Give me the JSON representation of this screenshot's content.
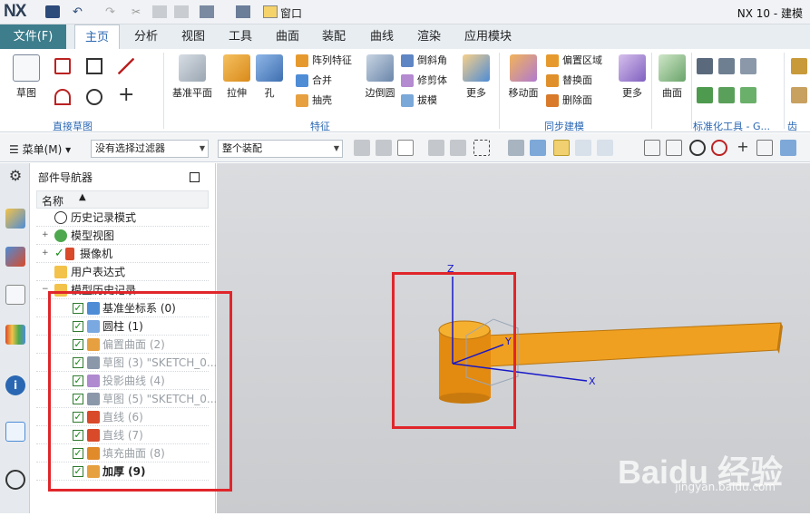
{
  "app": {
    "logo": "NX",
    "title": "NX 10 - 建模"
  },
  "quick_access": {
    "window_menu": "窗口"
  },
  "menu": {
    "file": "文件(F)",
    "tabs": [
      "主页",
      "分析",
      "视图",
      "工具",
      "曲面",
      "装配",
      "曲线",
      "渲染",
      "应用模块"
    ]
  },
  "ribbon": {
    "sketch": "草图",
    "group1": "直接草图",
    "datum_plane": "基准平面",
    "extrude": "拉伸",
    "hole": "孔",
    "pattern_feature": "阵列特征",
    "combine": "合并",
    "shell": "抽壳",
    "edge_blend": "边倒圆",
    "chamfer": "倒斜角",
    "trim_body": "修剪体",
    "draft": "拔模",
    "more": "更多",
    "group2": "特征",
    "move_face": "移动面",
    "offset_region": "偏置区域",
    "replace_face": "替换面",
    "delete_face": "删除面",
    "more2": "更多",
    "group3": "同步建模",
    "surface": "曲面",
    "group4": "标准化工具 - G...",
    "group5": "齿轮..."
  },
  "toolbar": {
    "menu": "菜单(M)",
    "filter": "没有选择过滤器",
    "assembly": "整个装配"
  },
  "navigator": {
    "title": "部件导航器",
    "col_name": "名称",
    "top_items": [
      {
        "label": "历史记录模式"
      },
      {
        "label": "模型视图"
      },
      {
        "label": "摄像机"
      },
      {
        "label": "用户表达式"
      },
      {
        "label": "模型历史记录"
      }
    ],
    "features": [
      {
        "label": "基准坐标系 (0)",
        "active": true,
        "checked": true
      },
      {
        "label": "圆柱 (1)",
        "active": true,
        "checked": true
      },
      {
        "label": "偏置曲面 (2)",
        "active": false,
        "checked": true
      },
      {
        "label": "草图 (3) \"SKETCH_0...",
        "active": false,
        "checked": true
      },
      {
        "label": "投影曲线 (4)",
        "active": false,
        "checked": true
      },
      {
        "label": "草图 (5) \"SKETCH_0...",
        "active": false,
        "checked": true
      },
      {
        "label": "直线 (6)",
        "active": false,
        "checked": true
      },
      {
        "label": "直线 (7)",
        "active": false,
        "checked": true
      },
      {
        "label": "填充曲面 (8)",
        "active": false,
        "checked": true
      },
      {
        "label": "加厚 (9)",
        "active": true,
        "checked": true
      }
    ]
  },
  "viewport": {
    "axis_z": "Z",
    "axis_y": "Y",
    "axis_x": "X"
  },
  "watermark": {
    "brand": "Baidu 经验",
    "url": "jingyan.baidu.com"
  },
  "colors": {
    "accent": "#2a67b3",
    "file_tab": "#3e7d8c",
    "highlight": "#e0262b",
    "part": "#f0a020"
  }
}
